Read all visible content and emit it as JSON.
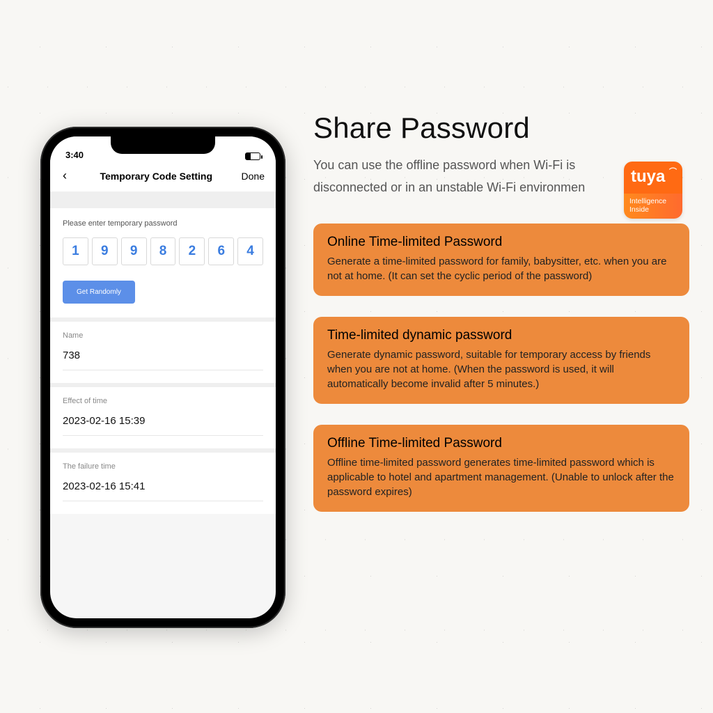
{
  "phone": {
    "status_time": "3:40",
    "nav": {
      "back_icon": "‹",
      "title": "Temporary Code Setting",
      "done": "Done"
    },
    "prompt": "Please enter temporary password",
    "code_digits": [
      "1",
      "9",
      "9",
      "8",
      "2",
      "6",
      "4"
    ],
    "get_random_label": "Get Randomly",
    "fields": {
      "name_label": "Name",
      "name_value": "738",
      "effect_label": "Effect of time",
      "effect_value": "2023-02-16 15:39",
      "failure_label": "The failure time",
      "failure_value": "2023-02-16 15:41"
    }
  },
  "right": {
    "headline": "Share Password",
    "description": "You can use the offline password when Wi-Fi is disconnected or in an unstable Wi-Fi environmen",
    "tuya": {
      "brand": "tuya",
      "tagline_l1": "Intelligence",
      "tagline_l2": "Inside"
    },
    "cards": [
      {
        "title": "Online Time-limited Password",
        "body": "Generate a time-limited password for family, babysitter, etc. when you are not at home.  (It can set the cyclic period of the password)"
      },
      {
        "title": "Time-limited dynamic password",
        "body": "Generate dynamic password, suitable for temporary access by friends when you are not at home. (When the password is used, it will automatically become invalid after 5 minutes.)"
      },
      {
        "title": "Offline Time-limited Password",
        "body": "Offline time-limited password generates time-limited password which is applicable to hotel and apartment management. (Unable to unlock after the password expires)"
      }
    ]
  }
}
